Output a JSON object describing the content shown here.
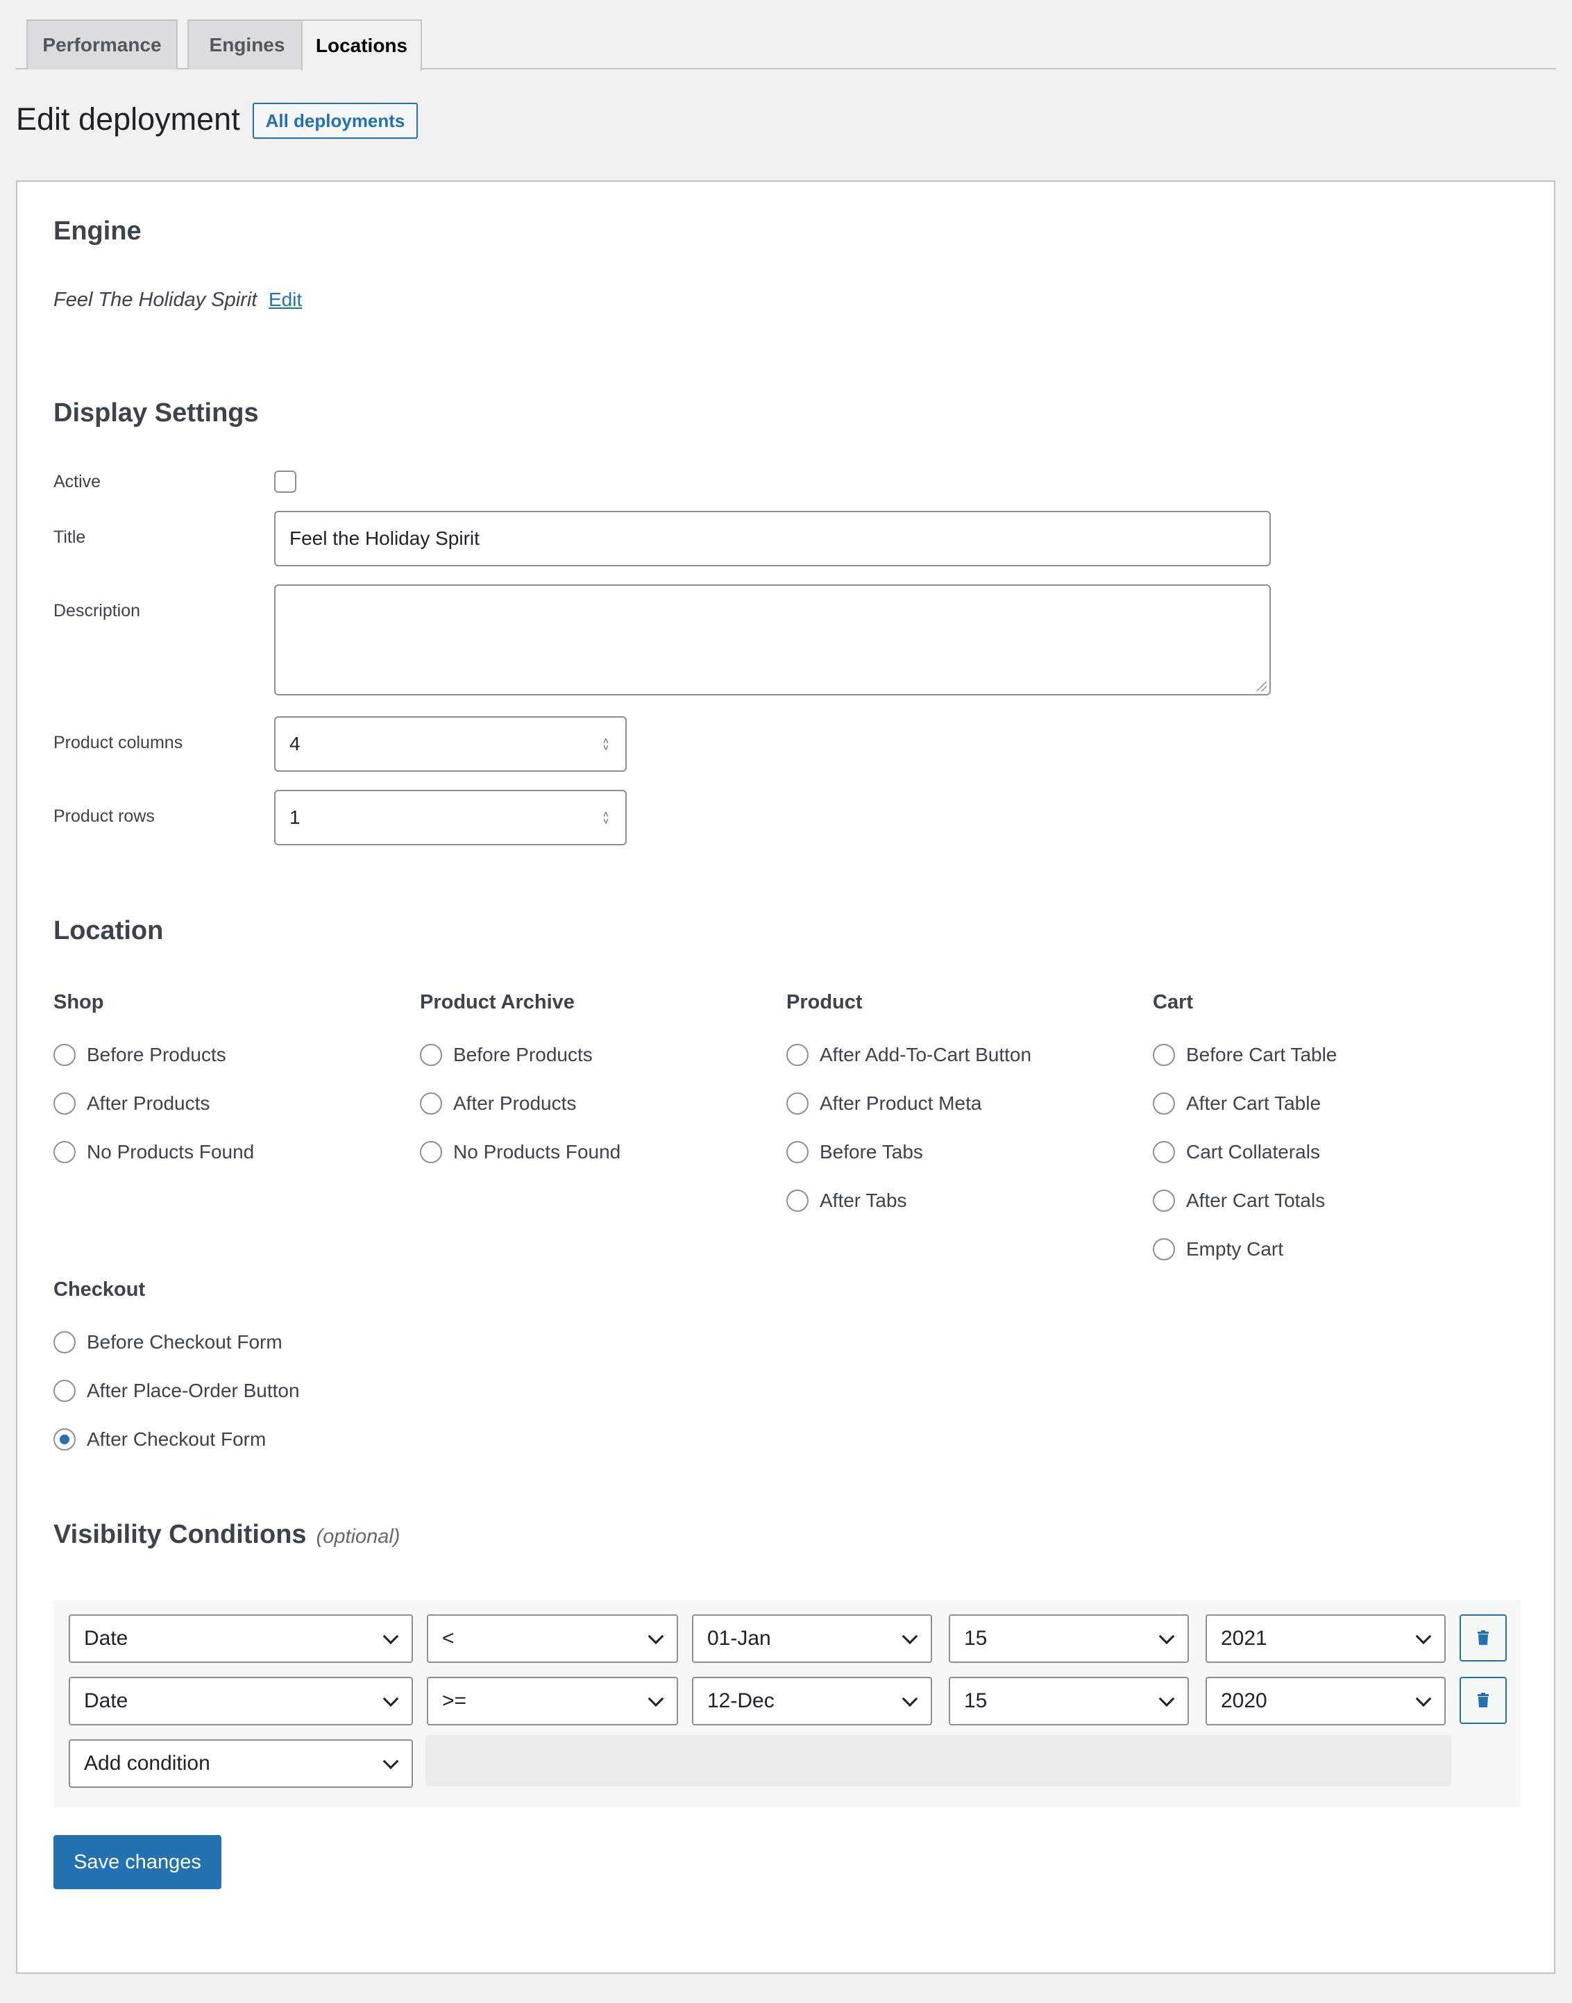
{
  "tabs": [
    {
      "label": "Performance",
      "active": false
    },
    {
      "label": "Engines",
      "active": false
    },
    {
      "label": "Locations",
      "active": true
    }
  ],
  "page": {
    "title": "Edit deployment",
    "all_deployments_label": "All deployments"
  },
  "engine": {
    "heading": "Engine",
    "name": "Feel The Holiday Spirit",
    "edit_label": "Edit"
  },
  "display": {
    "heading": "Display Settings",
    "active_label": "Active",
    "active_checked": false,
    "title_label": "Title",
    "title_value": "Feel the Holiday Spirit",
    "description_label": "Description",
    "description_value": "",
    "columns_label": "Product columns",
    "columns_value": "4",
    "rows_label": "Product rows",
    "rows_value": "1"
  },
  "location": {
    "heading": "Location",
    "groups": {
      "shop": {
        "title": "Shop",
        "options": [
          "Before Products",
          "After Products",
          "No Products Found"
        ]
      },
      "archive": {
        "title": "Product Archive",
        "options": [
          "Before Products",
          "After Products",
          "No Products Found"
        ]
      },
      "product": {
        "title": "Product",
        "options": [
          "After Add-To-Cart Button",
          "After Product Meta",
          "Before Tabs",
          "After Tabs"
        ]
      },
      "cart": {
        "title": "Cart",
        "options": [
          "Before Cart Table",
          "After Cart Table",
          "Cart Collaterals",
          "After Cart Totals",
          "Empty Cart"
        ]
      },
      "checkout": {
        "title": "Checkout",
        "options": [
          "Before Checkout Form",
          "After Place-Order Button",
          "After Checkout Form"
        ]
      }
    },
    "selected": "After Checkout Form"
  },
  "visibility": {
    "heading": "Visibility Conditions",
    "optional_label": "(optional)",
    "conditions": [
      {
        "type": "Date",
        "operator": "<",
        "date": "01-Jan",
        "hour": "15",
        "year": "2021"
      },
      {
        "type": "Date",
        "operator": ">=",
        "date": "12-Dec",
        "hour": "15",
        "year": "2020"
      }
    ],
    "add_condition_label": "Add condition"
  },
  "actions": {
    "save_label": "Save changes"
  },
  "colors": {
    "accent": "#2271b1",
    "background": "#f1f1f1",
    "panel": "#ffffff"
  },
  "icons": {
    "delete": "trash-icon",
    "select": "chevron-down-icon",
    "stepper": "stepper-icon"
  }
}
